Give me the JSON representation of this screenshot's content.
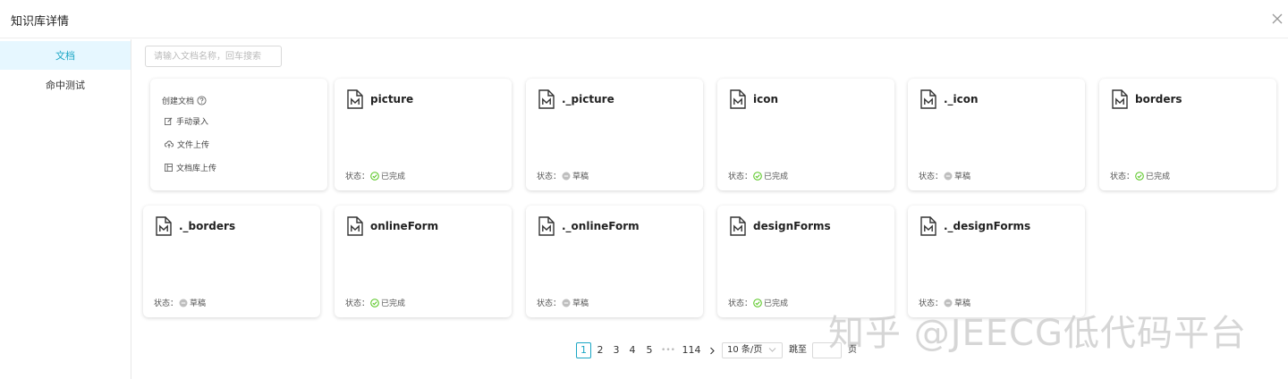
{
  "header": {
    "title": "知识库详情"
  },
  "sidebar": {
    "items": [
      {
        "label": "文档",
        "active": true
      },
      {
        "label": "命中测试",
        "active": false
      }
    ]
  },
  "search": {
    "placeholder": "请输入文档名称，回车搜索",
    "value": ""
  },
  "create": {
    "title": "创建文档",
    "options": [
      {
        "label": "手动录入",
        "icon": "edit-icon"
      },
      {
        "label": "文件上传",
        "icon": "cloud-upload-icon"
      },
      {
        "label": "文档库上传",
        "icon": "library-icon"
      }
    ]
  },
  "status_prefix": "状态：",
  "status_labels": {
    "done": "已完成",
    "draft": "草稿"
  },
  "colors": {
    "accent": "#1aa6c4",
    "done": "#52c41a",
    "draft": "#bfbfbf"
  },
  "documents": [
    {
      "name": "picture",
      "status": "done"
    },
    {
      "name": "._picture",
      "status": "draft"
    },
    {
      "name": "icon",
      "status": "done"
    },
    {
      "name": "._icon",
      "status": "draft"
    },
    {
      "name": "borders",
      "status": "done"
    },
    {
      "name": "._borders",
      "status": "draft"
    },
    {
      "name": "onlineForm",
      "status": "done"
    },
    {
      "name": "._onlineForm",
      "status": "draft"
    },
    {
      "name": "designForms",
      "status": "done"
    },
    {
      "name": "._designForms",
      "status": "draft"
    }
  ],
  "pagination": {
    "pages": [
      "1",
      "2",
      "3",
      "4",
      "5"
    ],
    "current": "1",
    "ellipsis": "•••",
    "last": "114",
    "page_size": "10 条/页",
    "jump_label": "跳至",
    "page_suffix": "页"
  },
  "watermark": "知乎 @JEECG低代码平台"
}
